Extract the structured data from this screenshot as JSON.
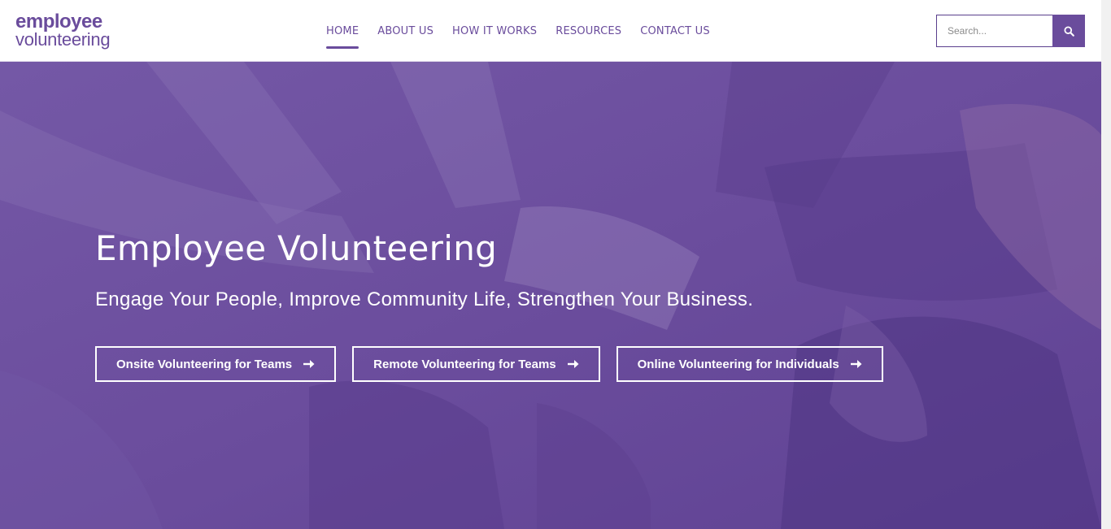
{
  "brand": {
    "logo_line1": "employee",
    "logo_line2": "volunteering",
    "logo_color": "#6a4c9c"
  },
  "nav": {
    "items": [
      {
        "label": "HOME",
        "active": true
      },
      {
        "label": "ABOUT US",
        "active": false
      },
      {
        "label": "HOW IT WORKS",
        "active": false
      },
      {
        "label": "RESOURCES",
        "active": false
      },
      {
        "label": "CONTACT US",
        "active": false
      }
    ]
  },
  "search": {
    "placeholder": "Search...",
    "value": "",
    "icon": "search-icon"
  },
  "hero": {
    "title": "Employee Volunteering",
    "subtitle": "Engage Your People, Improve Community Life, Strengthen Your Business.",
    "buttons": [
      {
        "label": "Onsite Volunteering for Teams",
        "icon": "arrow-right-icon"
      },
      {
        "label": "Remote Volunteering for Teams",
        "icon": "arrow-right-icon"
      },
      {
        "label": "Online Volunteering for Individuals",
        "icon": "arrow-right-icon"
      }
    ],
    "overlay_color": "#6b4d9d"
  },
  "colors": {
    "accent": "#6a4c9c",
    "text_on_hero": "#ffffff"
  }
}
